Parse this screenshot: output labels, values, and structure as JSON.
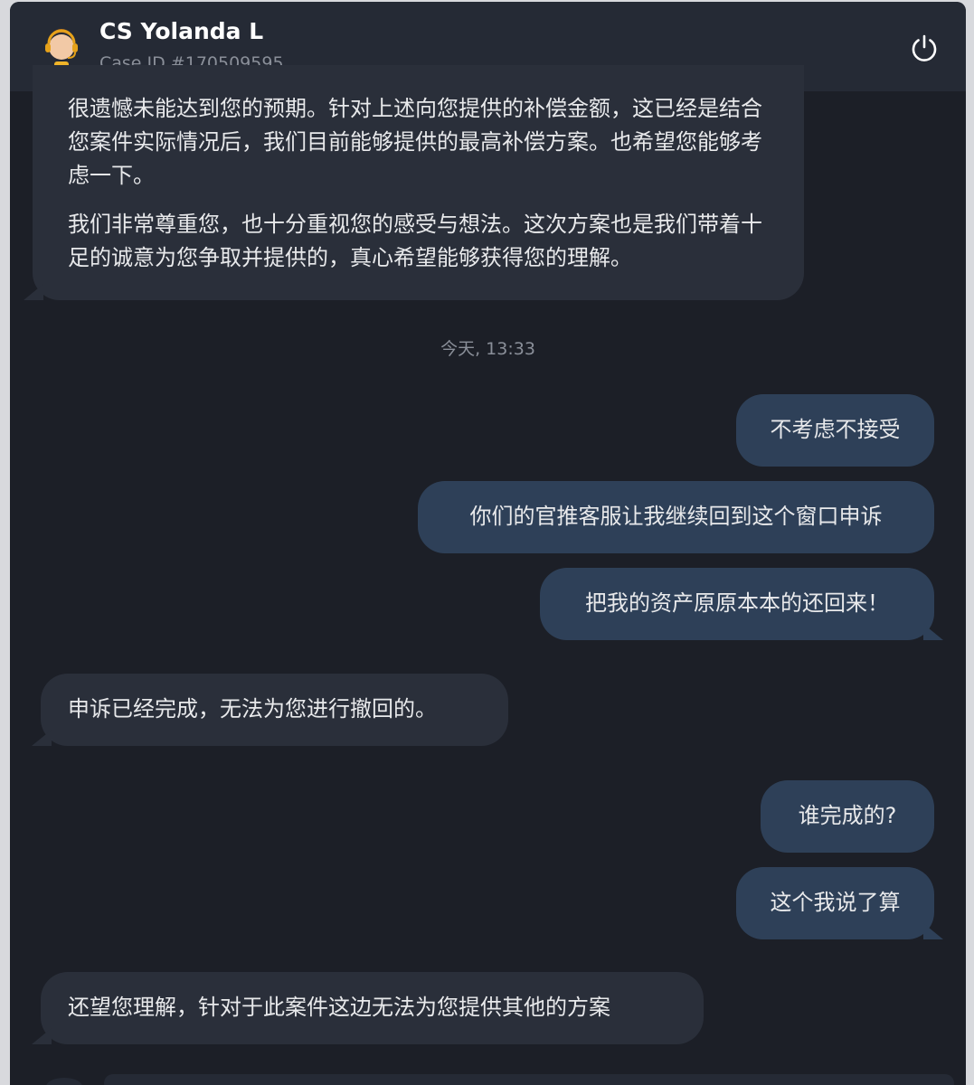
{
  "header": {
    "agent_name": "CS Yolanda L",
    "case_id": "Case ID #170509595",
    "avatar_icon": "support-agent-icon",
    "power_icon": "power-icon"
  },
  "messages_top": {
    "para1": "很遗憾未能达到您的预期。针对上述向您提供的补偿金额，这已经是结合您案件实际情况后，我们目前能够提供的最高补偿方案。也希望您能够考虑一下。",
    "para2": "我们非常尊重您，也十分重视您的感受与想法。这次方案也是我们带着十足的诚意为您争取并提供的，真心希望能够获得您的理解。"
  },
  "timestamp": "今天, 13:33",
  "messages": [
    {
      "from": "user",
      "text": "不考虑不接受"
    },
    {
      "from": "user",
      "text": "你们的官推客服让我继续回到这个窗口申诉"
    },
    {
      "from": "user",
      "text": "把我的资产原原本本的还回来！"
    },
    {
      "from": "agent",
      "text": "申诉已经完成，无法为您进行撤回的。"
    },
    {
      "from": "user",
      "text": "谁完成的?"
    },
    {
      "from": "user",
      "text": "这个我说了算"
    },
    {
      "from": "agent",
      "text": "还望您理解，针对于此案件这边无法为您提供其他的方案"
    }
  ],
  "colors": {
    "background": "#1c1f27",
    "header": "#252a35",
    "agent_bubble": "#2a2f3a",
    "user_bubble": "#2e4058"
  }
}
